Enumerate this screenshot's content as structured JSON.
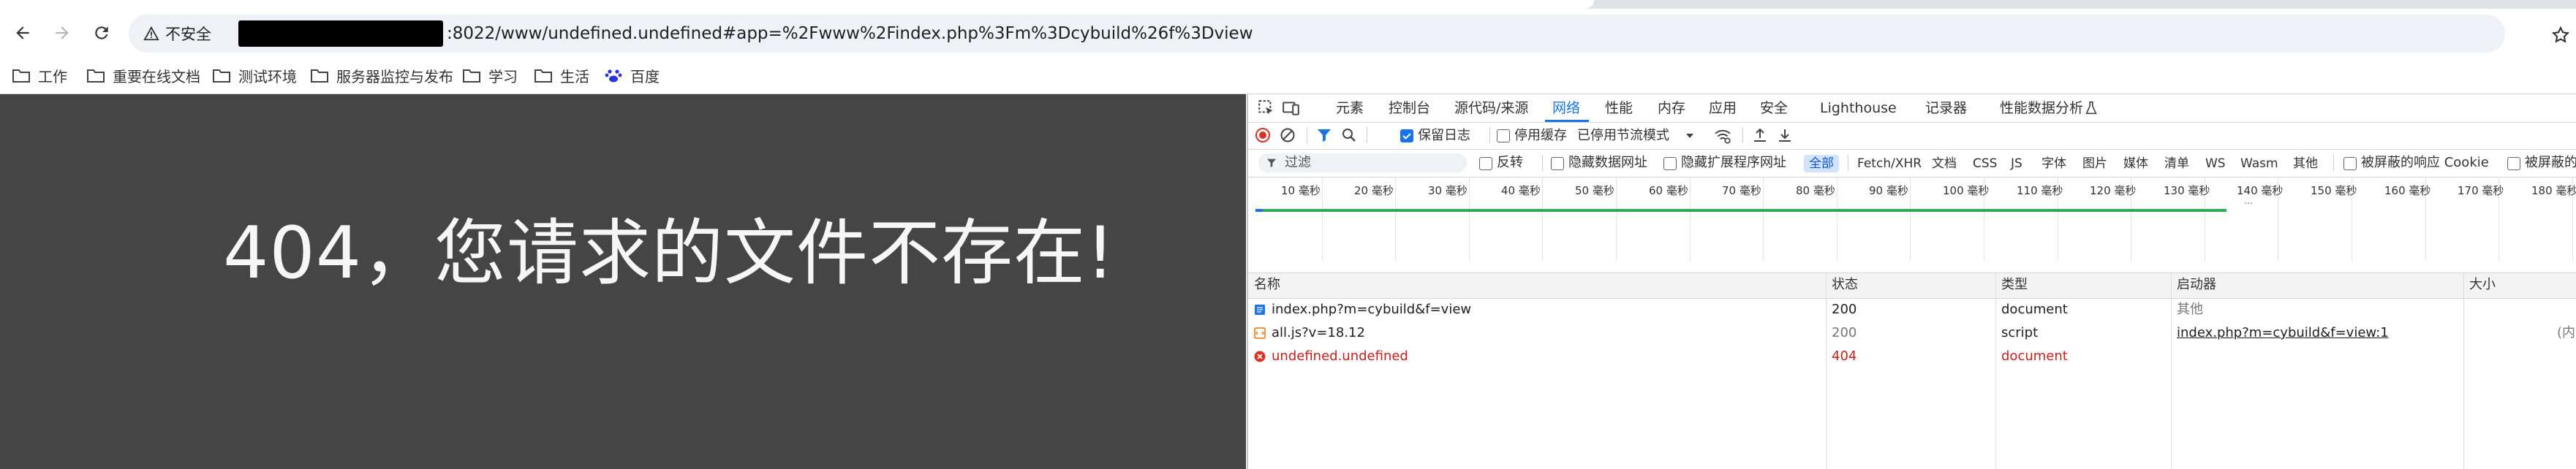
{
  "browser": {
    "security_label": "不安全",
    "url": ":8022/www/undefined.undefined#app=%2Fwww%2Findex.php%3Fm%3Dcybuild%26f%3Dview",
    "bookmarks": [
      "工作",
      "重要在线文档",
      "测试环境",
      "服务器监控与发布",
      "学习",
      "生活",
      "百度"
    ]
  },
  "page": {
    "message": "404，您请求的文件不存在!"
  },
  "devtools": {
    "tabs": [
      "元素",
      "控制台",
      "源代码/来源",
      "网络",
      "性能",
      "内存",
      "应用",
      "安全",
      "Lighthouse",
      "记录器",
      "性能数据分析"
    ],
    "active_tab": "网络",
    "toolbar": {
      "preserve_log": "保留日志",
      "disable_cache": "停用缓存",
      "throttle": "已停用节流模式"
    },
    "filter": {
      "placeholder": "过滤",
      "invert": "反转",
      "hide_data_urls": "隐藏数据网址",
      "hide_extension_urls": "隐藏扩展程序网址",
      "types": [
        "全部",
        "Fetch/XHR",
        "文档",
        "CSS",
        "JS",
        "字体",
        "图片",
        "媒体",
        "清单",
        "WS",
        "Wasm",
        "其他"
      ],
      "active_type": "全部",
      "blocked_cookies": "被屏蔽的响应 Cookie",
      "blocked_requests": "被屏蔽的"
    },
    "timeline_ticks": [
      "10 毫秒",
      "20 毫秒",
      "30 毫秒",
      "40 毫秒",
      "50 毫秒",
      "60 毫秒",
      "70 毫秒",
      "80 毫秒",
      "90 毫秒",
      "100 毫秒",
      "110 毫秒",
      "120 毫秒",
      "130 毫秒",
      "140 毫秒",
      "150 毫秒",
      "160 毫秒",
      "170 毫秒",
      "180 毫秒"
    ],
    "columns": [
      "名称",
      "状态",
      "类型",
      "启动器",
      "大小"
    ],
    "requests": [
      {
        "name": "index.php?m=cybuild&f=view",
        "status": "200",
        "type": "document",
        "initiator": "其他",
        "size": "",
        "icon": "document-icon",
        "error": false
      },
      {
        "name": "all.js?v=18.12",
        "status": "200",
        "type": "script",
        "initiator": "index.php?m=cybuild&f=view:1",
        "size": "(内",
        "icon": "script-icon",
        "error": false
      },
      {
        "name": "undefined.undefined",
        "status": "404",
        "type": "document",
        "initiator": "",
        "size": "",
        "icon": "error-icon",
        "error": true
      }
    ],
    "colors": {
      "accent": "#1a73e8",
      "error": "#c5221f",
      "page_bg": "#454545"
    }
  }
}
